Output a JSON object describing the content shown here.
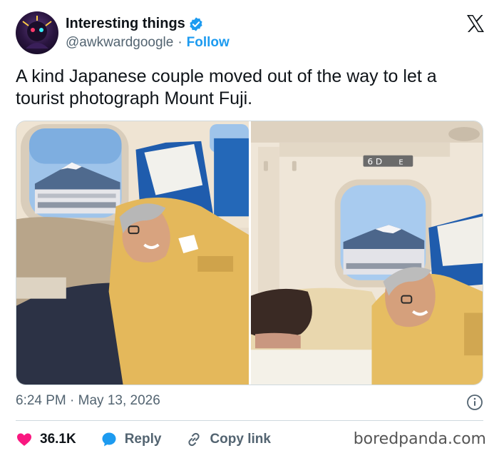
{
  "author": {
    "display_name": "Interesting things",
    "handle": "@awkwardgoogle",
    "separator": "·",
    "follow_label": "Follow",
    "verified": true
  },
  "tweet": {
    "text": "A kind Japanese couple moved out of the way to let a tourist photograph Mount Fuji.",
    "timestamp": "6:24 PM · May 13, 2026",
    "media_count": 2
  },
  "media": {
    "right_photo_sign": "6 D",
    "right_photo_sign_extra": "E"
  },
  "actions": {
    "likes": "36.1K",
    "reply_label": "Reply",
    "copy_link_label": "Copy link"
  },
  "icons": {
    "like": "heart-icon",
    "reply": "speech-bubble-icon",
    "copy": "link-icon",
    "info": "info-icon",
    "platform": "x-logo-icon",
    "verified": "verified-badge-icon"
  },
  "colors": {
    "accent": "#1d9bf0",
    "heart": "#f91880",
    "muted": "#536471",
    "text": "#0f1419"
  },
  "watermark": "boredpanda.com"
}
